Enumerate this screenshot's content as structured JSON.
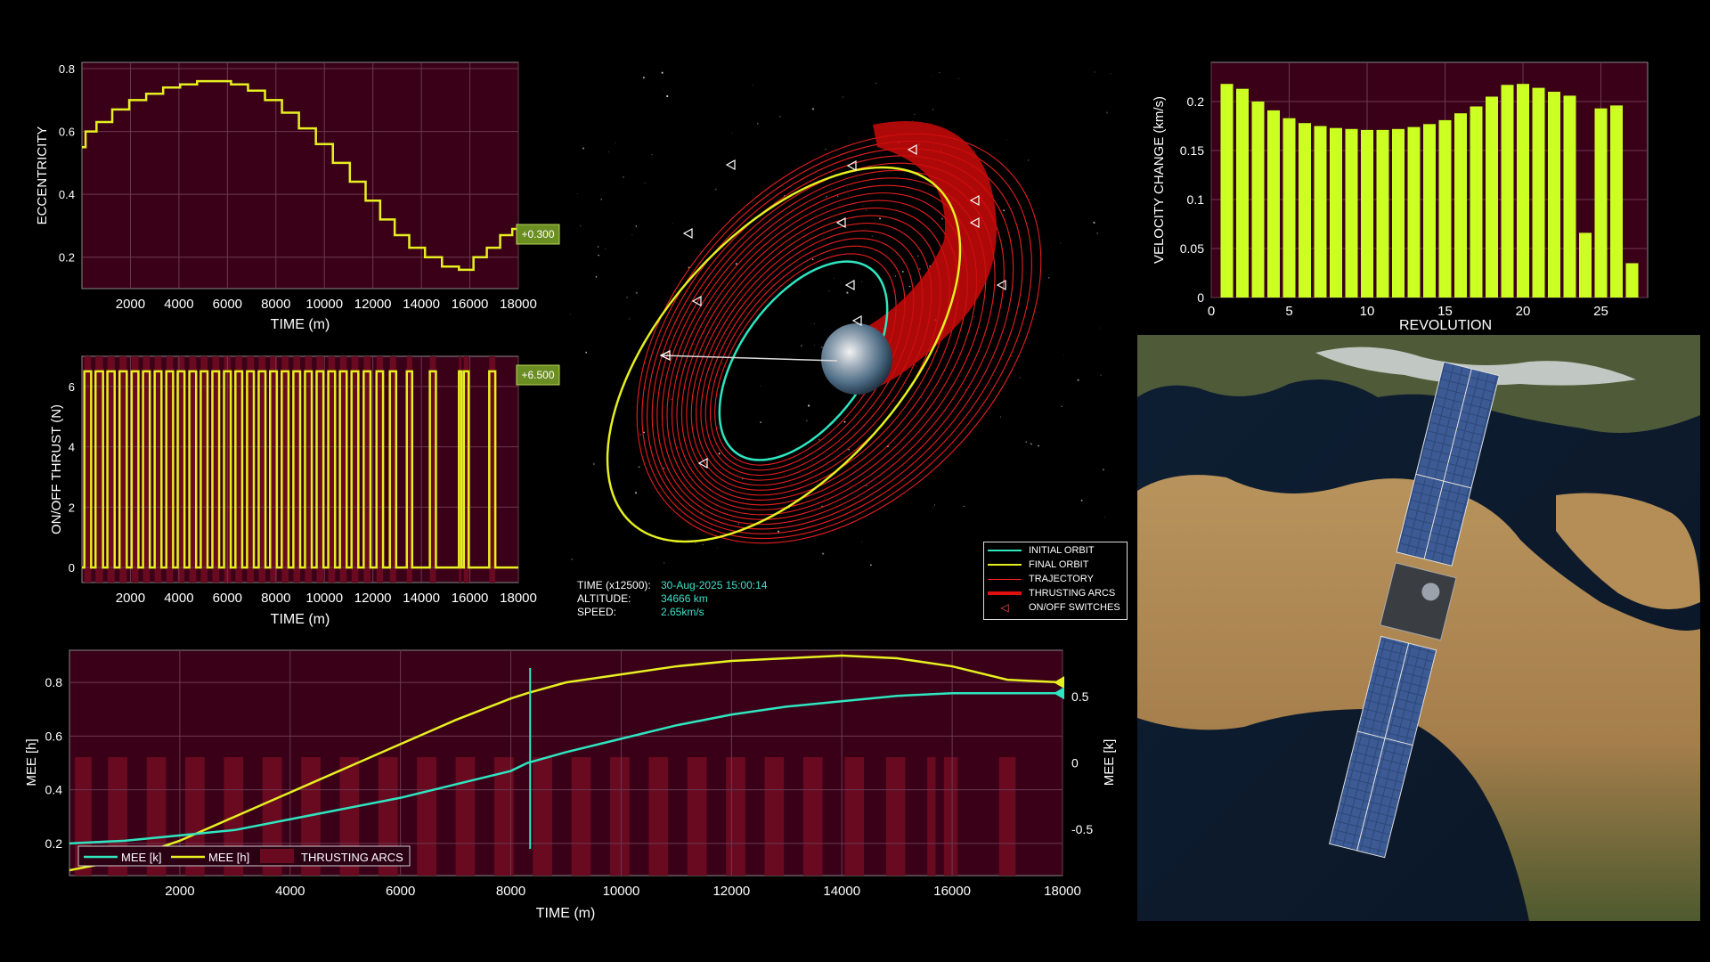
{
  "colors": {
    "plot_bg": "#3a0018",
    "plot_line_yellow": "#e6f020",
    "plot_line_cyan": "#2ee6c0",
    "bar_fill": "#ccff22",
    "orbit_red": "#ff2222",
    "thrust_band": "#6a0a20",
    "badge_bg": "#6b8e23"
  },
  "ecc_chart": {
    "ylabel": "ECCENTRICITY",
    "xlabel": "TIME (m)",
    "yticks": [
      "0.2",
      "0.4",
      "0.6",
      "0.8"
    ],
    "xticks": [
      "2000",
      "4000",
      "6000",
      "8000",
      "10000",
      "12000",
      "14000",
      "16000",
      "18000"
    ],
    "badge": "+0.300"
  },
  "thrust_chart": {
    "ylabel": "ON/OFF THRUST (N)",
    "xlabel": "TIME (m)",
    "yticks": [
      "0",
      "2",
      "4",
      "6"
    ],
    "xticks": [
      "2000",
      "4000",
      "6000",
      "8000",
      "10000",
      "12000",
      "14000",
      "16000",
      "18000"
    ],
    "badge": "+6.500"
  },
  "mee_chart": {
    "ylabel_left": "MEE [h]",
    "ylabel_right": "MEE [k]",
    "xlabel": "TIME (m)",
    "yticks_left": [
      "0.2",
      "0.4",
      "0.6",
      "0.8"
    ],
    "yticks_right": [
      "-0.5",
      "0",
      "0.5"
    ],
    "xticks": [
      "2000",
      "4000",
      "6000",
      "8000",
      "10000",
      "12000",
      "14000",
      "16000",
      "18000"
    ],
    "legend": [
      "MEE [k]",
      "MEE [h]",
      "THRUSTING ARCS"
    ]
  },
  "dv_chart": {
    "ylabel": "VELOCITY CHANGE (km/s)",
    "xlabel": "REVOLUTION",
    "yticks": [
      "0",
      "0.05",
      "0.1",
      "0.15",
      "0.2"
    ],
    "xticks": [
      "0",
      "5",
      "10",
      "15",
      "20",
      "25"
    ]
  },
  "readout": {
    "time_label": "TIME (x12500):",
    "time_value": "30-Aug-2025 15:00:14",
    "alt_label": "ALTITUDE:",
    "alt_value": "34666 km",
    "speed_label": "SPEED:",
    "speed_value": "2.65km/s"
  },
  "orbit_legend": {
    "initial": "INITIAL ORBIT",
    "final": "FINAL ORBIT",
    "trajectory": "TRAJECTORY",
    "thrusting": "THRUSTING ARCS",
    "switches": "ON/OFF SWITCHES"
  },
  "chart_data": [
    {
      "type": "line",
      "ylabel": "ECCENTRICITY",
      "xlabel": "TIME (m)",
      "xlim": [
        0,
        18000
      ],
      "ylim": [
        0.1,
        0.82
      ],
      "x": [
        0,
        300,
        900,
        1600,
        2300,
        3000,
        3700,
        4400,
        5100,
        5800,
        6500,
        7200,
        7900,
        8600,
        9300,
        10000,
        10700,
        11400,
        12000,
        12600,
        13200,
        13800,
        14500,
        15200,
        15900,
        16400,
        17000,
        17500,
        18000
      ],
      "series": [
        {
          "name": "",
          "values": [
            0.55,
            0.6,
            0.63,
            0.67,
            0.7,
            0.72,
            0.74,
            0.75,
            0.76,
            0.76,
            0.75,
            0.73,
            0.7,
            0.66,
            0.61,
            0.56,
            0.5,
            0.44,
            0.38,
            0.32,
            0.27,
            0.23,
            0.2,
            0.17,
            0.16,
            0.2,
            0.23,
            0.27,
            0.29
          ]
        }
      ]
    },
    {
      "type": "line",
      "ylabel": "ON/OFF THRUST (N)",
      "xlabel": "TIME (m)",
      "xlim": [
        0,
        18000
      ],
      "ylim": [
        -0.5,
        7
      ],
      "on_value": 6.5,
      "off_value": 0,
      "thrust_on_intervals": [
        [
          100,
          380
        ],
        [
          560,
          870
        ],
        [
          1050,
          1350
        ],
        [
          1550,
          1850
        ],
        [
          2050,
          2330
        ],
        [
          2520,
          2800
        ],
        [
          3000,
          3280
        ],
        [
          3480,
          3760
        ],
        [
          3950,
          4230
        ],
        [
          4430,
          4710
        ],
        [
          4900,
          5180
        ],
        [
          5380,
          5660
        ],
        [
          5860,
          6140
        ],
        [
          6330,
          6610
        ],
        [
          6810,
          7090
        ],
        [
          7290,
          7570
        ],
        [
          7760,
          8040
        ],
        [
          8240,
          8520
        ],
        [
          8720,
          9000
        ],
        [
          9200,
          9480
        ],
        [
          9680,
          9960
        ],
        [
          10160,
          10440
        ],
        [
          10640,
          10920
        ],
        [
          11120,
          11400
        ],
        [
          11620,
          11900
        ],
        [
          12150,
          12420
        ],
        [
          12700,
          12960
        ],
        [
          13400,
          13620
        ],
        [
          14350,
          14600
        ],
        [
          15550,
          15650
        ],
        [
          15750,
          15950
        ],
        [
          16800,
          17050
        ]
      ]
    },
    {
      "type": "line",
      "xlabel": "TIME (m)",
      "ylabel": "MEE [h]",
      "ylabel_right": "MEE [k]",
      "xlim": [
        0,
        18000
      ],
      "ylim": [
        0.08,
        0.92
      ],
      "ylim_right": [
        -0.85,
        0.85
      ],
      "x": [
        0,
        1000,
        2000,
        3000,
        4000,
        5000,
        6000,
        7000,
        8000,
        8300,
        9000,
        10000,
        11000,
        12000,
        13000,
        14000,
        15000,
        16000,
        17000,
        18000
      ],
      "series": [
        {
          "name": "MEE [h]",
          "axis": "left",
          "values": [
            0.1,
            0.14,
            0.21,
            0.3,
            0.39,
            0.48,
            0.57,
            0.66,
            0.74,
            0.76,
            0.8,
            0.83,
            0.86,
            0.88,
            0.89,
            0.9,
            0.89,
            0.86,
            0.81,
            0.8
          ]
        },
        {
          "name": "MEE [k]",
          "axis": "left",
          "values": [
            0.2,
            0.21,
            0.23,
            0.25,
            0.29,
            0.33,
            0.37,
            0.42,
            0.47,
            0.5,
            0.54,
            0.59,
            0.64,
            0.68,
            0.71,
            0.73,
            0.75,
            0.76,
            0.76,
            0.76
          ]
        }
      ],
      "marker_time": 8350,
      "thrusting_arcs": [
        [
          100,
          400
        ],
        [
          700,
          1050
        ],
        [
          1400,
          1750
        ],
        [
          2100,
          2450
        ],
        [
          2800,
          3150
        ],
        [
          3500,
          3850
        ],
        [
          4200,
          4550
        ],
        [
          4900,
          5250
        ],
        [
          5600,
          5950
        ],
        [
          6300,
          6650
        ],
        [
          7000,
          7350
        ],
        [
          7700,
          8050
        ],
        [
          8400,
          8750
        ],
        [
          9100,
          9450
        ],
        [
          9800,
          10150
        ],
        [
          10500,
          10850
        ],
        [
          11200,
          11550
        ],
        [
          11900,
          12250
        ],
        [
          12600,
          12950
        ],
        [
          13300,
          13650
        ],
        [
          14050,
          14400
        ],
        [
          14800,
          15150
        ],
        [
          15550,
          15700
        ],
        [
          15850,
          16100
        ],
        [
          16850,
          17150
        ]
      ]
    },
    {
      "type": "bar",
      "ylabel": "VELOCITY CHANGE (km/s)",
      "xlabel": "REVOLUTION",
      "xlim": [
        0,
        28
      ],
      "ylim": [
        0,
        0.24
      ],
      "categories": [
        1,
        2,
        3,
        4,
        5,
        6,
        7,
        8,
        9,
        10,
        11,
        12,
        13,
        14,
        15,
        16,
        17,
        18,
        19,
        20,
        21,
        22,
        23,
        24,
        25,
        26,
        27
      ],
      "values": [
        0.218,
        0.213,
        0.2,
        0.191,
        0.183,
        0.178,
        0.175,
        0.173,
        0.172,
        0.171,
        0.171,
        0.172,
        0.174,
        0.177,
        0.181,
        0.188,
        0.195,
        0.205,
        0.217,
        0.218,
        0.214,
        0.21,
        0.206,
        0.066,
        0.193,
        0.196,
        0.035
      ]
    }
  ]
}
